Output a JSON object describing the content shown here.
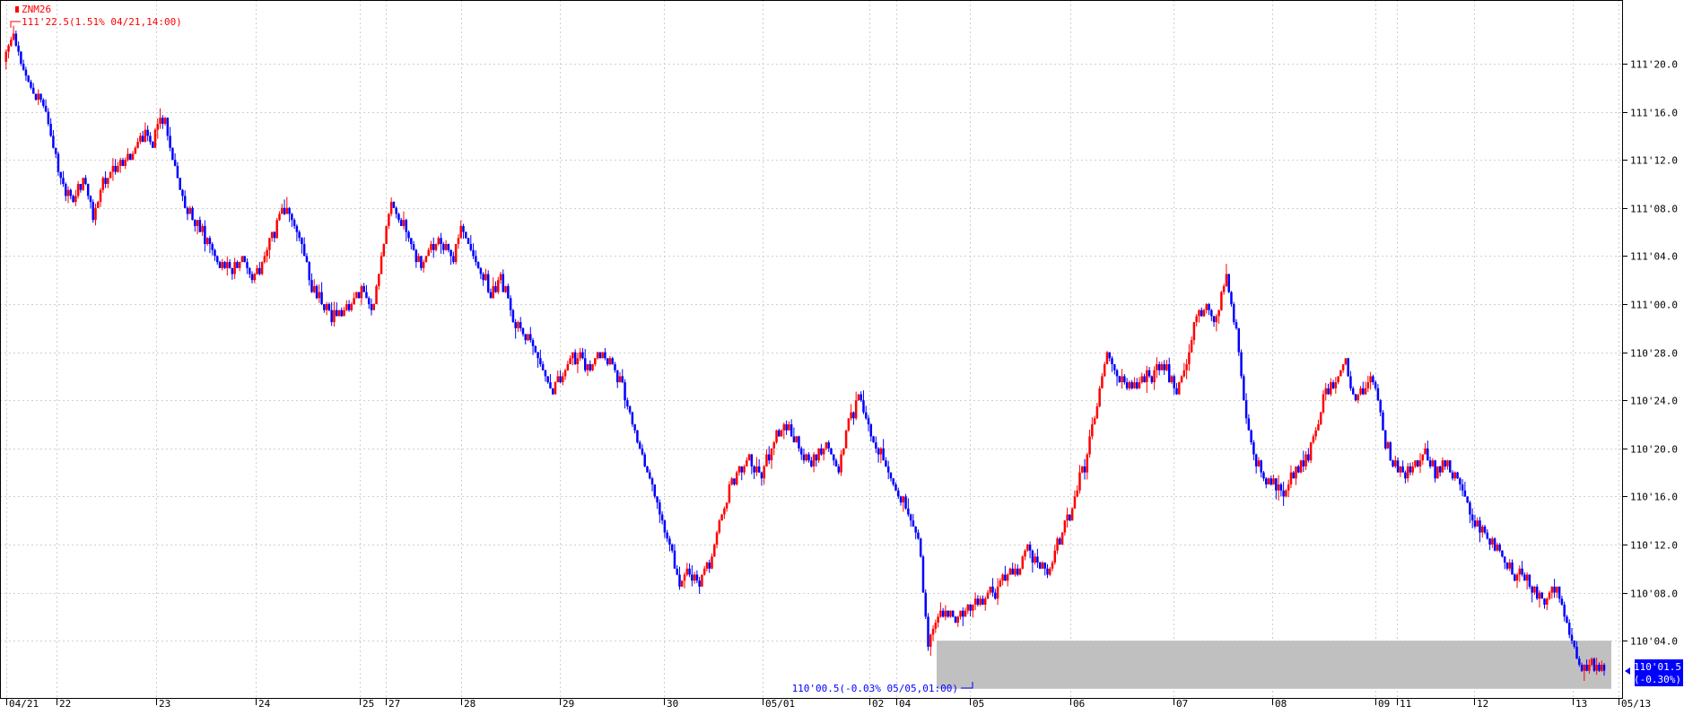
{
  "header": {
    "symbol": "ZNM26",
    "high_note": "111'22.5(1.51% 04/21,14:00)"
  },
  "annotations": {
    "low_note": "110'00.5(-0.03% 05/05,01:00)"
  },
  "last_price": {
    "price": "110'01.5",
    "change": "(-0.30%)"
  },
  "colors": {
    "up": "#ff0000",
    "down": "#0000ff",
    "grid": "#d0d0d0",
    "shade": "#c0c0c0",
    "axis": "#000000"
  },
  "chart_data": {
    "type": "candlestick",
    "title": "ZNM26",
    "ylim": [
      110.0,
      111.8125
    ],
    "yticks": [
      {
        "label": "111'20.0",
        "value": 111.625
      },
      {
        "label": "111'16.0",
        "value": 111.5
      },
      {
        "label": "111'12.0",
        "value": 111.375
      },
      {
        "label": "111'08.0",
        "value": 111.25
      },
      {
        "label": "111'04.0",
        "value": 111.125
      },
      {
        "label": "111'00.0",
        "value": 111.0
      },
      {
        "label": "110'28.0",
        "value": 110.875
      },
      {
        "label": "110'24.0",
        "value": 110.75
      },
      {
        "label": "110'20.0",
        "value": 110.625
      },
      {
        "label": "110'16.0",
        "value": 110.5
      },
      {
        "label": "110'12.0",
        "value": 110.375
      },
      {
        "label": "110'08.0",
        "value": 110.25
      },
      {
        "label": "110'04.0",
        "value": 110.125
      }
    ],
    "xticks": [
      "04/21",
      "22",
      "23",
      "24",
      "25",
      "27",
      "28",
      "29",
      "30",
      "05/01",
      "02",
      "04",
      "05",
      "06",
      "07",
      "08",
      "09",
      "11",
      "12",
      "13",
      "05/13"
    ],
    "shaded_band": {
      "from": 110.0,
      "to": 110.125,
      "x_start_label": "05",
      "x_end_label": "05/13"
    },
    "grid": true,
    "legend": "top-left",
    "series": [
      {
        "name": "ZNM26",
        "price_path": [
          111.63,
          111.7,
          111.6,
          111.55,
          111.53,
          111.4,
          111.3,
          111.28,
          111.33,
          111.22,
          111.32,
          111.34,
          111.36,
          111.4,
          111.44,
          111.42,
          111.5,
          111.38,
          111.28,
          111.22,
          111.18,
          111.14,
          111.1,
          111.09,
          111.12,
          111.07,
          111.1,
          111.18,
          111.25,
          111.22,
          111.16,
          111.04,
          111.0,
          110.97,
          110.97,
          111.0,
          111.05,
          110.98,
          111.12,
          111.26,
          111.23,
          111.15,
          111.1,
          111.15,
          111.16,
          111.12,
          111.2,
          111.14,
          111.08,
          111.03,
          111.07,
          110.98,
          110.93,
          110.9,
          110.85,
          110.77,
          110.82,
          110.85,
          110.86,
          110.82,
          110.88,
          110.85,
          110.8,
          110.72,
          110.62,
          110.55,
          110.45,
          110.38,
          110.27,
          110.3,
          110.28,
          110.33,
          110.42,
          110.52,
          110.57,
          110.6,
          110.55,
          110.62,
          110.67,
          110.68,
          110.62,
          110.6,
          110.62,
          110.63,
          110.57,
          110.7,
          110.75,
          110.69,
          110.62,
          110.57,
          110.52,
          110.46,
          110.4,
          110.12,
          110.18,
          110.19,
          110.19,
          110.2,
          110.22,
          110.24,
          110.26,
          110.3,
          110.32,
          110.36,
          110.33,
          110.29,
          110.38,
          110.45,
          110.52,
          110.62,
          110.74,
          110.88,
          110.82,
          110.78,
          110.8,
          110.82,
          110.84,
          110.82,
          110.78,
          110.86,
          110.97,
          111.0,
          110.95,
          111.08,
          110.92,
          110.7,
          110.58,
          110.55,
          110.51,
          110.53,
          110.56,
          110.6,
          110.66,
          110.78,
          110.8,
          110.84,
          110.75,
          110.78,
          110.8,
          110.62,
          110.58,
          110.56,
          110.58,
          110.6,
          110.56,
          110.6,
          110.56,
          110.5,
          110.43,
          110.4,
          110.37,
          110.34,
          110.3,
          110.28,
          110.25,
          110.23,
          110.26,
          110.2,
          110.1,
          110.07,
          110.05,
          110.05
        ]
      }
    ]
  }
}
